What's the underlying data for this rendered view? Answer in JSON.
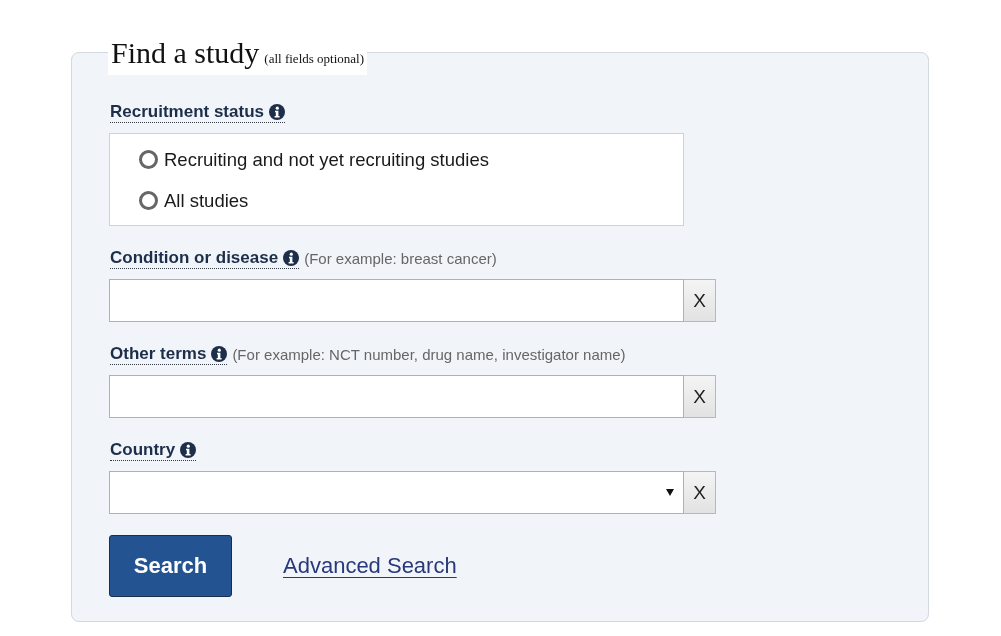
{
  "form": {
    "title": "Find a study",
    "subtitle": "(all fields optional)",
    "fields": [
      {
        "kind": "radio-group",
        "label": "Recruitment status",
        "options": [
          {
            "label": "Recruiting and not yet recruiting studies",
            "selected": false
          },
          {
            "label": "All studies",
            "selected": false
          }
        ]
      },
      {
        "kind": "text",
        "label": "Condition or disease",
        "hint": "(For example: breast cancer)",
        "clear_button": "X"
      },
      {
        "kind": "text",
        "label": "Other terms",
        "hint": "(For example: NCT number, drug name, investigator name)",
        "clear_button": "X"
      },
      {
        "kind": "select",
        "label": "Country",
        "clear_button": "X"
      }
    ],
    "actions": {
      "search_button": "Search",
      "advanced_link": "Advanced Search"
    }
  }
}
